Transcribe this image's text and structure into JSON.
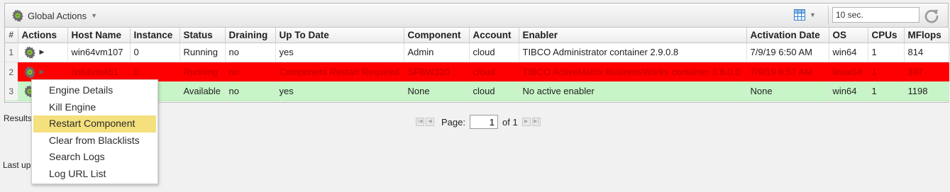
{
  "toolbar": {
    "global_actions_label": "Global Actions",
    "refresh_interval_value": "10 sec.",
    "icons": {
      "gear": "gear-icon",
      "grid": "grid-icon",
      "refresh": "refresh-icon",
      "caret": "caret-down-icon"
    }
  },
  "table": {
    "columns": [
      "#",
      "Actions",
      "Host Name",
      "Instance",
      "Status",
      "Draining",
      "Up To Date",
      "Component",
      "Account",
      "Enabler",
      "Activation Date",
      "OS",
      "CPUs",
      "MFlops"
    ],
    "rows": [
      {
        "num": "1",
        "host": "win64vm107",
        "instance": "0",
        "status": "Running",
        "draining": "no",
        "up_to_date": "yes",
        "component": "Admin",
        "account": "cloud",
        "enabler": "TIBCO Administrator container 2.9.0.8",
        "activation_date": "7/9/19 6:50 AM",
        "os": "win64",
        "cpus": "1",
        "mflops": "814"
      },
      {
        "num": "2",
        "host": "lin64vm461",
        "instance": "0",
        "status": "Running",
        "draining": "no",
        "up_to_date": "Component Restart Required",
        "component": "SFBW320",
        "account": "cloud",
        "enabler": "TIBCO ActiveMatrix BusinessWorks container 3.6.0.0",
        "activation_date": "7/9/19 6:57 AM",
        "os": "linux64",
        "cpus": "1",
        "mflops": "397"
      },
      {
        "num": "3",
        "host": "",
        "instance": "",
        "status": "Available",
        "draining": "no",
        "up_to_date": "yes",
        "component": "None",
        "account": "cloud",
        "enabler": "No active enabler",
        "activation_date": "None",
        "os": "win64",
        "cpus": "1",
        "mflops": "1198"
      }
    ],
    "row_colors": {
      "error": "#ff0000",
      "available": "#c7f5c7"
    }
  },
  "footer": {
    "results_label": "Results",
    "last_updated_label": "Last up",
    "page_label": "Page:",
    "page_value": "1",
    "of_label": "of 1"
  },
  "context_menu": {
    "items": [
      "Engine Details",
      "Kill Engine",
      "Restart Component",
      "Clear from Blacklists",
      "Search Logs",
      "Log URL List"
    ],
    "highlighted": "Restart Component",
    "highlight_color": "#f4e07c"
  }
}
